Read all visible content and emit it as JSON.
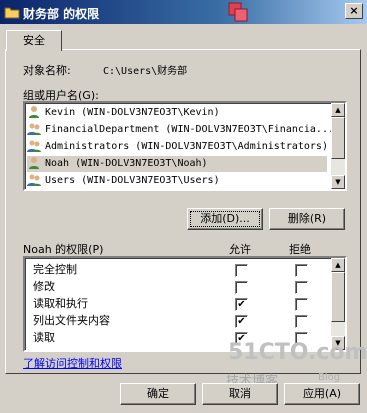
{
  "window": {
    "title": "财务部 的权限",
    "close_glyph": "×"
  },
  "tabs": [
    {
      "label": "安全"
    }
  ],
  "object": {
    "label": "对象名称:",
    "value": "C:\\Users\\财务部"
  },
  "users": {
    "label": "组或用户名(G):",
    "items": [
      {
        "name": "Kevin (WIN-DOLV3N7EO3T\\Kevin)",
        "icon": "user-icon",
        "selected": false
      },
      {
        "name": "FinancialDepartment (WIN-DOLV3N7EO3T\\Financia...",
        "icon": "group-icon",
        "selected": false
      },
      {
        "name": "Administrators (WIN-DOLV3N7EO3T\\Administrators)",
        "icon": "group-icon",
        "selected": false
      },
      {
        "name": "Noah (WIN-DOLV3N7EO3T\\Noah)",
        "icon": "user-icon",
        "selected": true
      },
      {
        "name": "Users (WIN-DOLV3N7EO3T\\Users)",
        "icon": "group-icon",
        "selected": false
      }
    ]
  },
  "buttons": {
    "add": "添加(D)...",
    "remove": "删除(R)",
    "ok": "确定",
    "cancel": "取消",
    "apply": "应用(A)"
  },
  "permissions": {
    "label": "Noah 的权限(P)",
    "allow_header": "允许",
    "deny_header": "拒绝",
    "rows": [
      {
        "name": "完全控制",
        "allow": false,
        "deny": false
      },
      {
        "name": "修改",
        "allow": false,
        "deny": false
      },
      {
        "name": "读取和执行",
        "allow": true,
        "deny": false
      },
      {
        "name": "列出文件夹内容",
        "allow": true,
        "deny": false
      },
      {
        "name": "读取",
        "allow": true,
        "deny": false
      }
    ]
  },
  "link": "了解访问控制和权限",
  "watermark": {
    "site": "51CTO.com",
    "sub": "技术博客",
    "blog": "Blog"
  }
}
